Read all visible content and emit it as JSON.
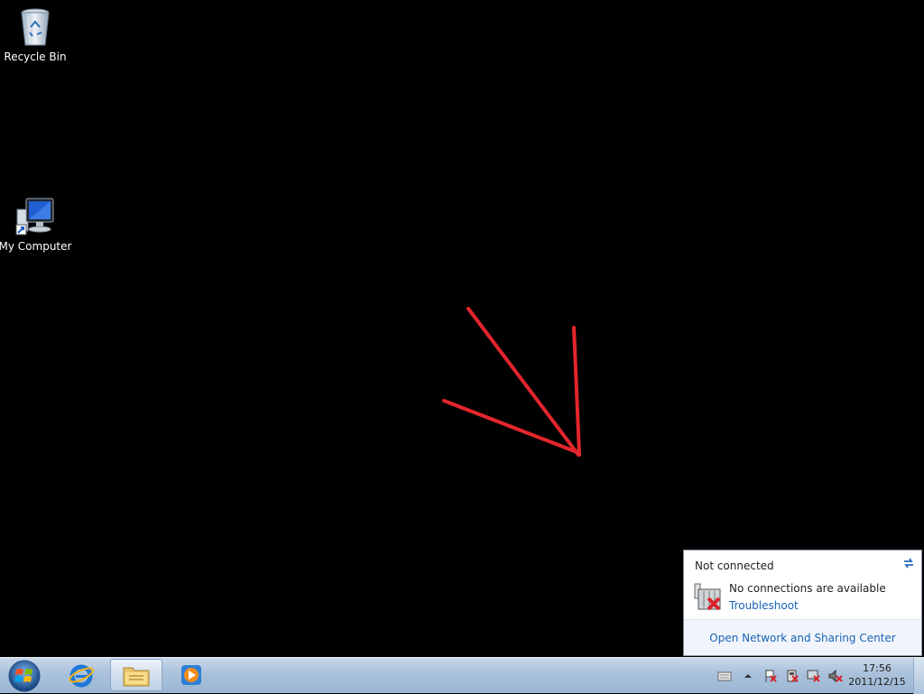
{
  "desktop": {
    "icons": [
      {
        "label": "Recycle Bin"
      },
      {
        "label": "My Computer"
      }
    ]
  },
  "annotation": {
    "color": "#e3262c"
  },
  "network_flyout": {
    "status_title": "Not connected",
    "connection_message": "No connections are available",
    "troubleshoot_link": "Troubleshoot",
    "footer_link": "Open Network and Sharing Center"
  },
  "taskbar": {
    "pinned": [
      {
        "name": "internet-explorer"
      },
      {
        "name": "windows-explorer"
      },
      {
        "name": "media-player"
      }
    ],
    "clock": {
      "time": "17:56",
      "date": "2011/12/15"
    }
  }
}
